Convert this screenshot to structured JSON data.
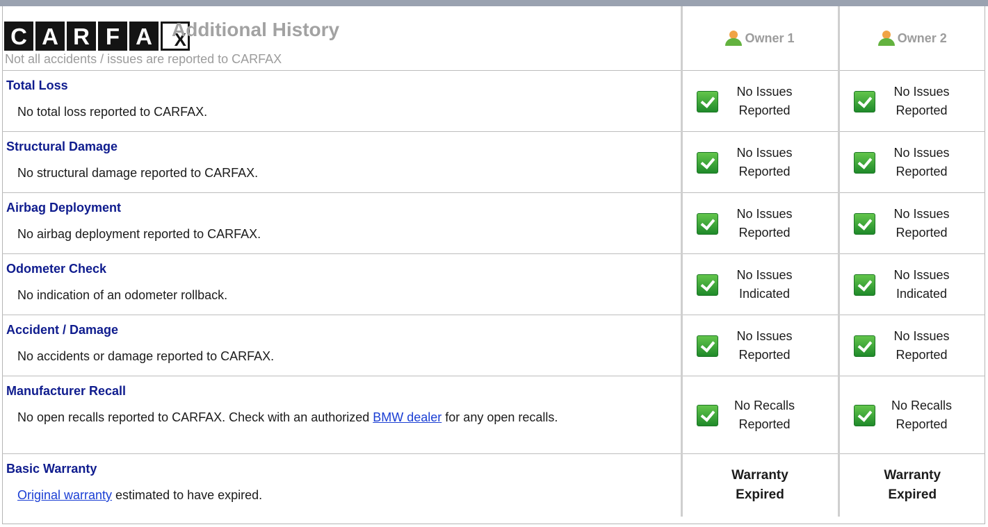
{
  "header": {
    "logo_letters": [
      "C",
      "A",
      "R",
      "F",
      "A",
      "X"
    ],
    "title": "Additional History",
    "subtitle": "Not all accidents / issues are reported to CARFAX",
    "owners": [
      "Owner 1",
      "Owner 2"
    ]
  },
  "rows": [
    {
      "title": "Total Loss",
      "desc": "No total loss reported to CARFAX.",
      "owner1": {
        "line1": "No Issues",
        "line2": "Reported"
      },
      "owner2": {
        "line1": "No Issues",
        "line2": "Reported"
      }
    },
    {
      "title": "Structural Damage",
      "desc": "No structural damage reported to CARFAX.",
      "owner1": {
        "line1": "No Issues",
        "line2": "Reported"
      },
      "owner2": {
        "line1": "No Issues",
        "line2": "Reported"
      }
    },
    {
      "title": "Airbag Deployment",
      "desc": "No airbag deployment reported to CARFAX.",
      "owner1": {
        "line1": "No Issues",
        "line2": "Reported"
      },
      "owner2": {
        "line1": "No Issues",
        "line2": "Reported"
      }
    },
    {
      "title": "Odometer Check",
      "desc": "No indication of an odometer rollback.",
      "owner1": {
        "line1": "No Issues",
        "line2": "Indicated"
      },
      "owner2": {
        "line1": "No Issues",
        "line2": "Indicated"
      }
    },
    {
      "title": "Accident / Damage",
      "desc": "No accidents or damage reported to CARFAX.",
      "owner1": {
        "line1": "No Issues",
        "line2": "Reported"
      },
      "owner2": {
        "line1": "No Issues",
        "line2": "Reported"
      }
    },
    {
      "title": "Manufacturer Recall",
      "desc_pre": "No open recalls reported to CARFAX. Check with an authorized ",
      "desc_link": "BMW dealer",
      "desc_post": " for any open recalls.",
      "owner1": {
        "line1": "No Recalls",
        "line2": "Reported"
      },
      "owner2": {
        "line1": "No Recalls",
        "line2": "Reported"
      }
    },
    {
      "title": "Basic Warranty",
      "desc_link": "Original warranty",
      "desc_post": " estimated to have expired.",
      "owner1": {
        "line1": "Warranty",
        "line2": "Expired"
      },
      "owner2": {
        "line1": "Warranty",
        "line2": "Expired"
      }
    }
  ],
  "colors": {
    "title_blue": "#0f1c8e",
    "link_blue": "#1a3ed4",
    "check_green": "#3aa53a",
    "header_gray": "#a2a2a2"
  },
  "icons": {
    "status": "check-icon",
    "owner": "person-icon"
  }
}
